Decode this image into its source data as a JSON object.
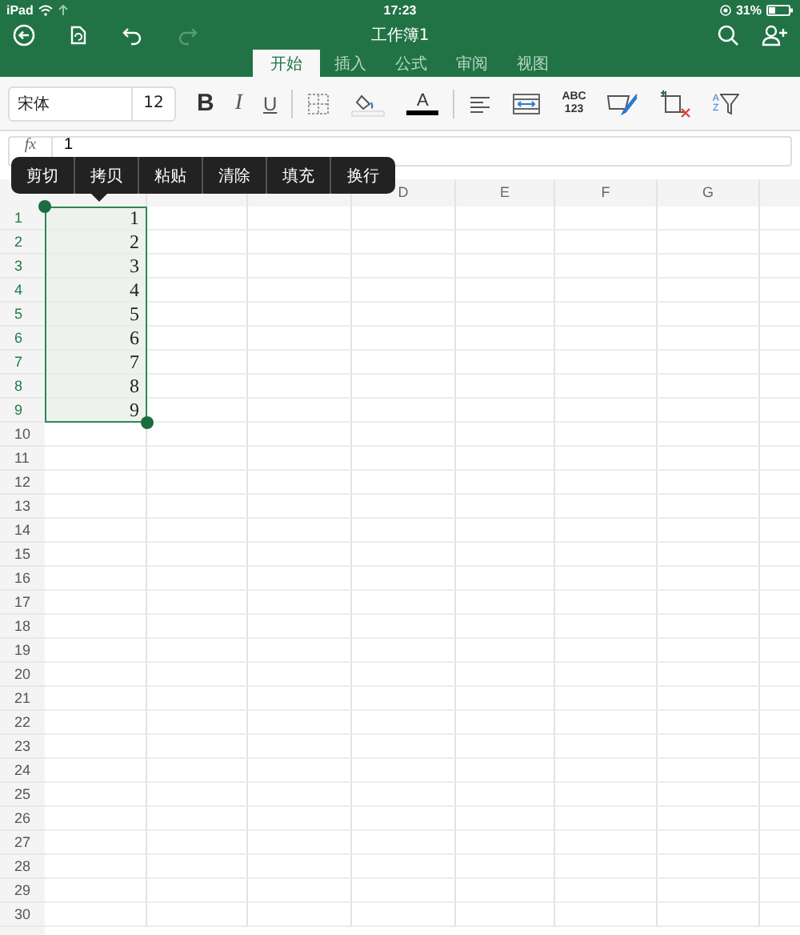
{
  "status_bar": {
    "carrier": "iPad",
    "time": "17:23",
    "battery": "31%"
  },
  "title_bar": {
    "title": "工作簿1",
    "redo_disabled": true
  },
  "tabs": [
    {
      "label": "开始",
      "selected": true
    },
    {
      "label": "插入",
      "selected": false
    },
    {
      "label": "公式",
      "selected": false
    },
    {
      "label": "审阅",
      "selected": false
    },
    {
      "label": "视图",
      "selected": false
    }
  ],
  "ribbon": {
    "font": "宋体",
    "size": "12",
    "bold": "B",
    "italic": "I",
    "underline": "U",
    "font_color": "A",
    "number_format": [
      "ABC",
      "123"
    ],
    "sort": [
      "A",
      "Z"
    ]
  },
  "formula_bar": {
    "label": "fx",
    "value": "1"
  },
  "context_menu": [
    "剪切",
    "拷贝",
    "粘贴",
    "清除",
    "填充",
    "换行"
  ],
  "columns": [
    "",
    "",
    "",
    "D",
    "E",
    "F",
    "G",
    ""
  ],
  "rows": [
    {
      "header": "1",
      "value": "1",
      "selected": true
    },
    {
      "header": "2",
      "value": "2",
      "selected": true
    },
    {
      "header": "3",
      "value": "3",
      "selected": true
    },
    {
      "header": "4",
      "value": "4",
      "selected": true
    },
    {
      "header": "5",
      "value": "5",
      "selected": true
    },
    {
      "header": "6",
      "value": "6",
      "selected": true
    },
    {
      "header": "7",
      "value": "7",
      "selected": true
    },
    {
      "header": "8",
      "value": "8",
      "selected": true
    },
    {
      "header": "9",
      "value": "9",
      "selected": true
    },
    {
      "header": "10",
      "value": "",
      "selected": false
    },
    {
      "header": "11",
      "value": "",
      "selected": false
    },
    {
      "header": "12",
      "value": "",
      "selected": false
    },
    {
      "header": "13",
      "value": "",
      "selected": false
    },
    {
      "header": "14",
      "value": "",
      "selected": false
    },
    {
      "header": "15",
      "value": "",
      "selected": false
    },
    {
      "header": "16",
      "value": "",
      "selected": false
    },
    {
      "header": "17",
      "value": "",
      "selected": false
    },
    {
      "header": "18",
      "value": "",
      "selected": false
    },
    {
      "header": "19",
      "value": "",
      "selected": false
    },
    {
      "header": "20",
      "value": "",
      "selected": false
    },
    {
      "header": "21",
      "value": "",
      "selected": false
    },
    {
      "header": "22",
      "value": "",
      "selected": false
    },
    {
      "header": "23",
      "value": "",
      "selected": false
    },
    {
      "header": "24",
      "value": "",
      "selected": false
    },
    {
      "header": "25",
      "value": "",
      "selected": false
    },
    {
      "header": "26",
      "value": "",
      "selected": false
    },
    {
      "header": "27",
      "value": "",
      "selected": false
    },
    {
      "header": "28",
      "value": "",
      "selected": false
    },
    {
      "header": "29",
      "value": "",
      "selected": false
    },
    {
      "header": "30",
      "value": "",
      "selected": false
    }
  ]
}
